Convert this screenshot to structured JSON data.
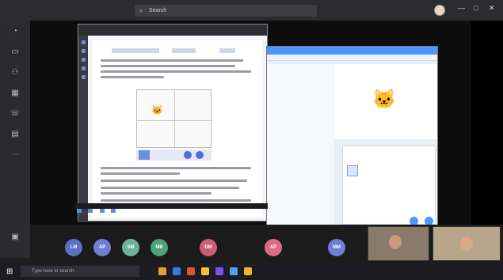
{
  "titlebar": {
    "search_placeholder": "Search",
    "window_controls": [
      "—",
      "□",
      "✕"
    ]
  },
  "rail": {
    "icons": [
      "activity-icon",
      "chat-icon",
      "teams-icon",
      "calendar-icon",
      "calls-icon",
      "files-icon",
      "more-icon"
    ]
  },
  "participants": [
    {
      "initials": "LM",
      "color": "#5b6fc7"
    },
    {
      "initials": "AP",
      "color": "#6f7fd6"
    },
    {
      "initials": "SM",
      "color": "#6fb29c"
    },
    {
      "initials": "MB",
      "color": "#4aa37e"
    },
    {
      "initials": "DM",
      "color": "#d15a7a"
    },
    {
      "initials": "AP",
      "color": "#e06a84"
    },
    {
      "initials": "MM",
      "color": "#6a7fd8"
    }
  ],
  "taskbar": {
    "search_placeholder": "Type here to search",
    "app_colors": [
      "#e0a12f",
      "#2f80ed",
      "#e0542f",
      "#f2c230",
      "#7e4ff0",
      "#4aa3f0",
      "#f2b030"
    ],
    "clock_time": "",
    "clock_date": ""
  }
}
